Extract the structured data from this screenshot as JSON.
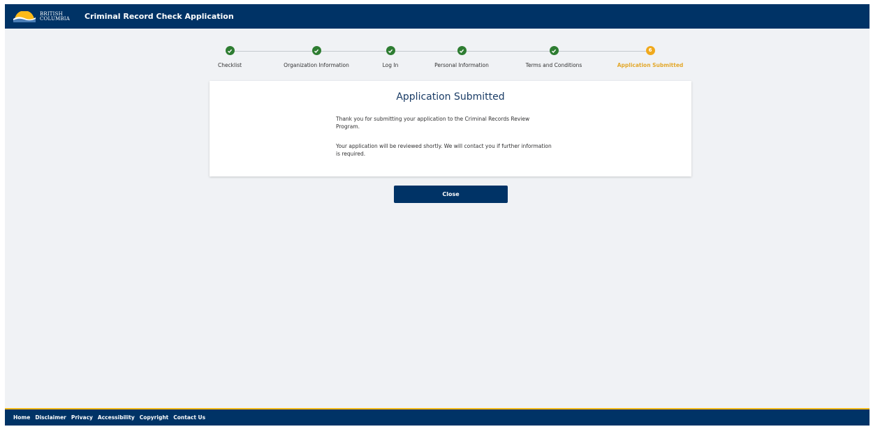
{
  "header": {
    "logo_line1": "BRITISH",
    "logo_line2": "COLUMBIA",
    "title": "Criminal Record Check Application"
  },
  "stepper": {
    "steps": [
      {
        "label": "Checklist",
        "status": "complete"
      },
      {
        "label": "Organization Information",
        "status": "complete"
      },
      {
        "label": "Log In",
        "status": "complete"
      },
      {
        "label": "Personal Information",
        "status": "complete"
      },
      {
        "label": "Terms and Conditions",
        "status": "complete"
      },
      {
        "label": "Application Submitted",
        "status": "active",
        "number": "6"
      }
    ]
  },
  "confirmation": {
    "title": "Application Submitted",
    "paragraph1_line1": "Thank you for submitting your application to the Criminal Records Review",
    "paragraph1_line2": "Program.",
    "paragraph2_line1": "Your application will be reviewed shortly. We will contact you if further information",
    "paragraph2_line2": "is required."
  },
  "actions": {
    "close_label": "Close"
  },
  "footer": {
    "links": [
      "Home",
      "Disclaimer",
      "Privacy",
      "Accessibility",
      "Copyright",
      "Contact Us"
    ]
  },
  "colors": {
    "brand_navy": "#003366",
    "accent_gold": "#fcba19",
    "step_complete": "#2e7d32",
    "step_active": "#f0a91d",
    "page_background": "#f0f2f5"
  }
}
